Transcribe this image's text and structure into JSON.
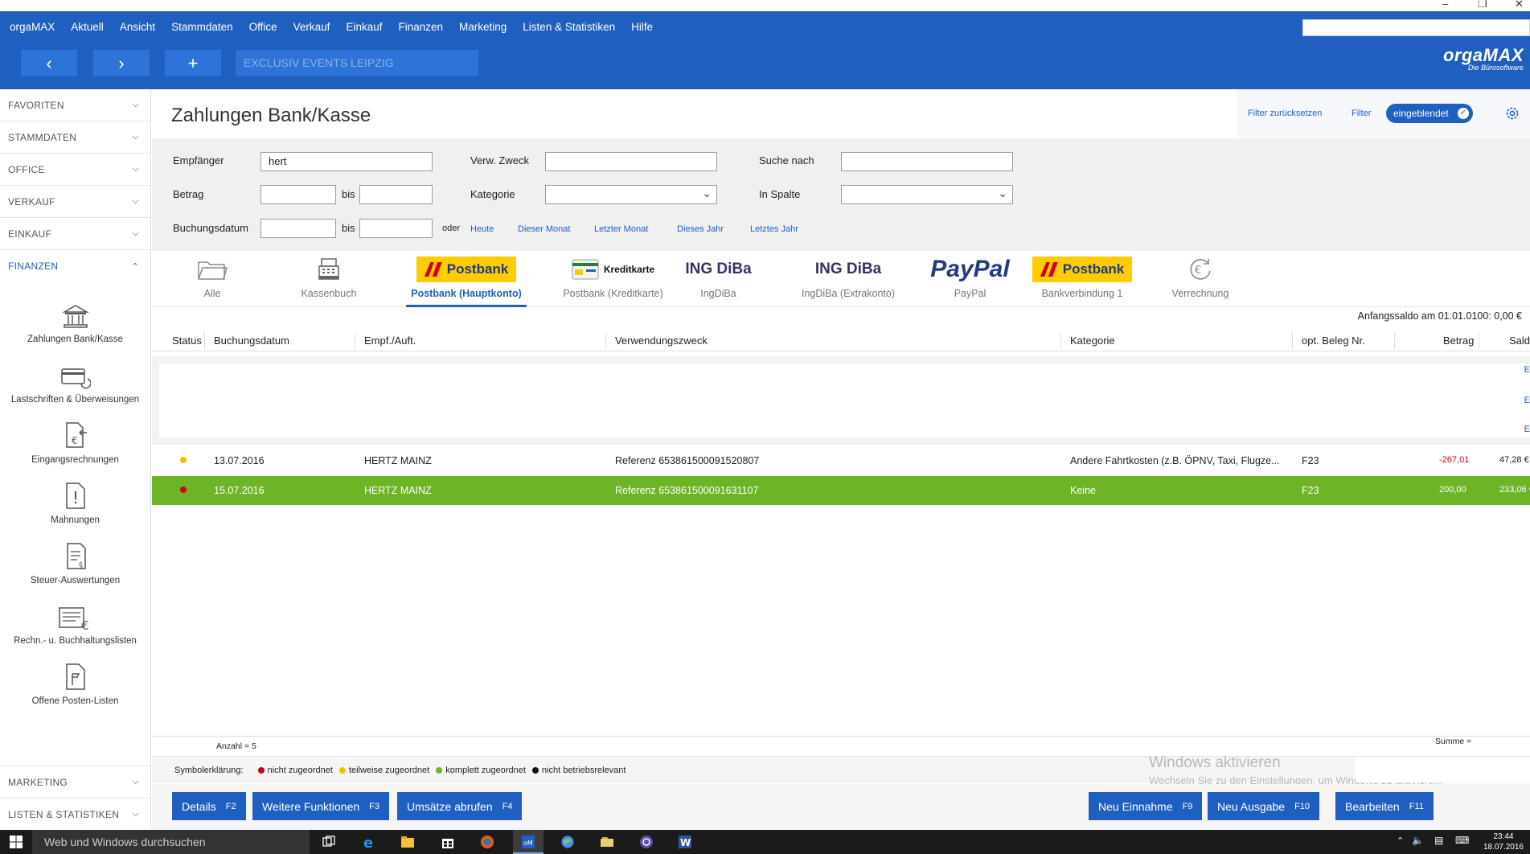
{
  "menu": [
    "orgaMAX",
    "Aktuell",
    "Ansicht",
    "Stammdaten",
    "Office",
    "Verkauf",
    "Einkauf",
    "Finanzen",
    "Marketing",
    "Listen & Statistiken",
    "Hilfe"
  ],
  "nav": {
    "back": "‹",
    "forward": "›",
    "add": "+"
  },
  "company": "EXCLUSIV EVENTS LEIPZIG",
  "logo": {
    "main": "orgaMAX",
    "sub": "Die Bürosoftware"
  },
  "sidebar": {
    "sections_top": [
      "FAVORITEN",
      "STAMMDATEN",
      "OFFICE",
      "VERKAUF",
      "EINKAUF"
    ],
    "active_section": "FINANZEN",
    "items": [
      "Zahlungen Bank/Kasse",
      "Lastschriften & Überweisungen",
      "Eingangsrechnungen",
      "Mahnungen",
      "Steuer-Auswertungen",
      "Rechn.- u. Buchhaltungslisten",
      "Offene Posten-Listen"
    ],
    "sections_bottom": [
      "MARKETING",
      "LISTEN & STATISTIKEN"
    ]
  },
  "page": {
    "title": "Zahlungen Bank/Kasse"
  },
  "filterbar": {
    "reset": "Filter zurücksetzen",
    "filter": "Filter",
    "state": "eingeblendet"
  },
  "filters": {
    "empfaenger_label": "Empfänger",
    "empfaenger_value": "hert",
    "betrag_label": "Betrag",
    "bis": "bis",
    "buchungsdatum_label": "Buchungsdatum",
    "oder": "oder",
    "zweck_label": "Verw. Zweck",
    "kategorie_label": "Kategorie",
    "suche_label": "Suche nach",
    "spalte_label": "In Spalte",
    "quick": [
      "Heute",
      "Dieser Monat",
      "Letzter Monat",
      "Dieses Jahr",
      "Letztes Jahr"
    ]
  },
  "accounts": [
    {
      "label": "Alle",
      "logo": "folder-icon"
    },
    {
      "label": "Kassenbuch",
      "logo": "cash-register-icon"
    },
    {
      "label": "Postbank (Hauptkonto)",
      "logo": "Postbank",
      "active": true
    },
    {
      "label": "Postbank (Kreditkarte)",
      "logo": "Kreditkarte"
    },
    {
      "label": "IngDiBa",
      "logo": "ING DiBa"
    },
    {
      "label": "IngDiBa (Extrakonto)",
      "logo": "ING DiBa"
    },
    {
      "label": "PayPal",
      "logo": "PayPal"
    },
    {
      "label": "Bankverbindung 1",
      "logo": "Postbank"
    },
    {
      "label": "Verrechnung",
      "logo": "euro-cycle-icon"
    }
  ],
  "anfangssaldo": "Anfangssaldo am 01.01.0100: 0,00 €",
  "table": {
    "headers": [
      "Status",
      "Buchungsdatum",
      "Empf./Auft.",
      "Verwendungszweck",
      "Kategorie",
      "opt. Beleg Nr.",
      "Betrag",
      "Saldo"
    ],
    "rows": [
      {
        "status_color": "#f2c200",
        "date": "13.07.2016",
        "recipient": "HERTZ MAINZ",
        "purpose": "Referenz 653861500091520807",
        "category": "Andere Fahrtkosten (z.B. ÖPNV, Taxi, Flugze...",
        "beleg": "F23",
        "amount": "-267,01",
        "saldo": "47,28 €",
        "selected": false
      },
      {
        "status_color": "#d0021b",
        "date": "15.07.2016",
        "recipient": "HERTZ MAINZ",
        "purpose": "Referenz 653861500091631107",
        "category": "Keine",
        "beleg": "F23",
        "amount": "200,00",
        "saldo": "233,06 €",
        "selected": true
      }
    ]
  },
  "footer": {
    "count": "Anzahl = 5",
    "sum": "Summe ="
  },
  "legend": {
    "title": "Symbolerklärung:",
    "items": [
      {
        "label": "nicht zugeordnet",
        "color": "#d0021b"
      },
      {
        "label": "teilweise zugeordnet",
        "color": "#f2c200"
      },
      {
        "label": "komplett zugeordnet",
        "color": "#6db526"
      },
      {
        "label": "nicht betriebsrelevant",
        "color": "#111111"
      }
    ]
  },
  "activation": {
    "title": "Windows aktivieren",
    "text": "Wechseln Sie zu den Einstellungen, um Windows zu aktivieren."
  },
  "buttons": {
    "details": "Details",
    "details_key": "F2",
    "weitere": "Weitere Funktionen",
    "weitere_key": "F3",
    "umsaetze": "Umsätze abrufen",
    "umsaetze_key": "F4",
    "einnahme": "Neu Einnahme",
    "einnahme_key": "F9",
    "ausgabe": "Neu Ausgabe",
    "ausgabe_key": "F10",
    "bearbeiten": "Bearbeiten",
    "bearbeiten_key": "F11"
  },
  "taskbar": {
    "search": "Web und Windows durchsuchen",
    "time": "23:44",
    "date": "18.07.2016"
  },
  "colors": {
    "brand": "#1f5fbf",
    "selected_row": "#6db526",
    "negative": "#d0021b"
  }
}
